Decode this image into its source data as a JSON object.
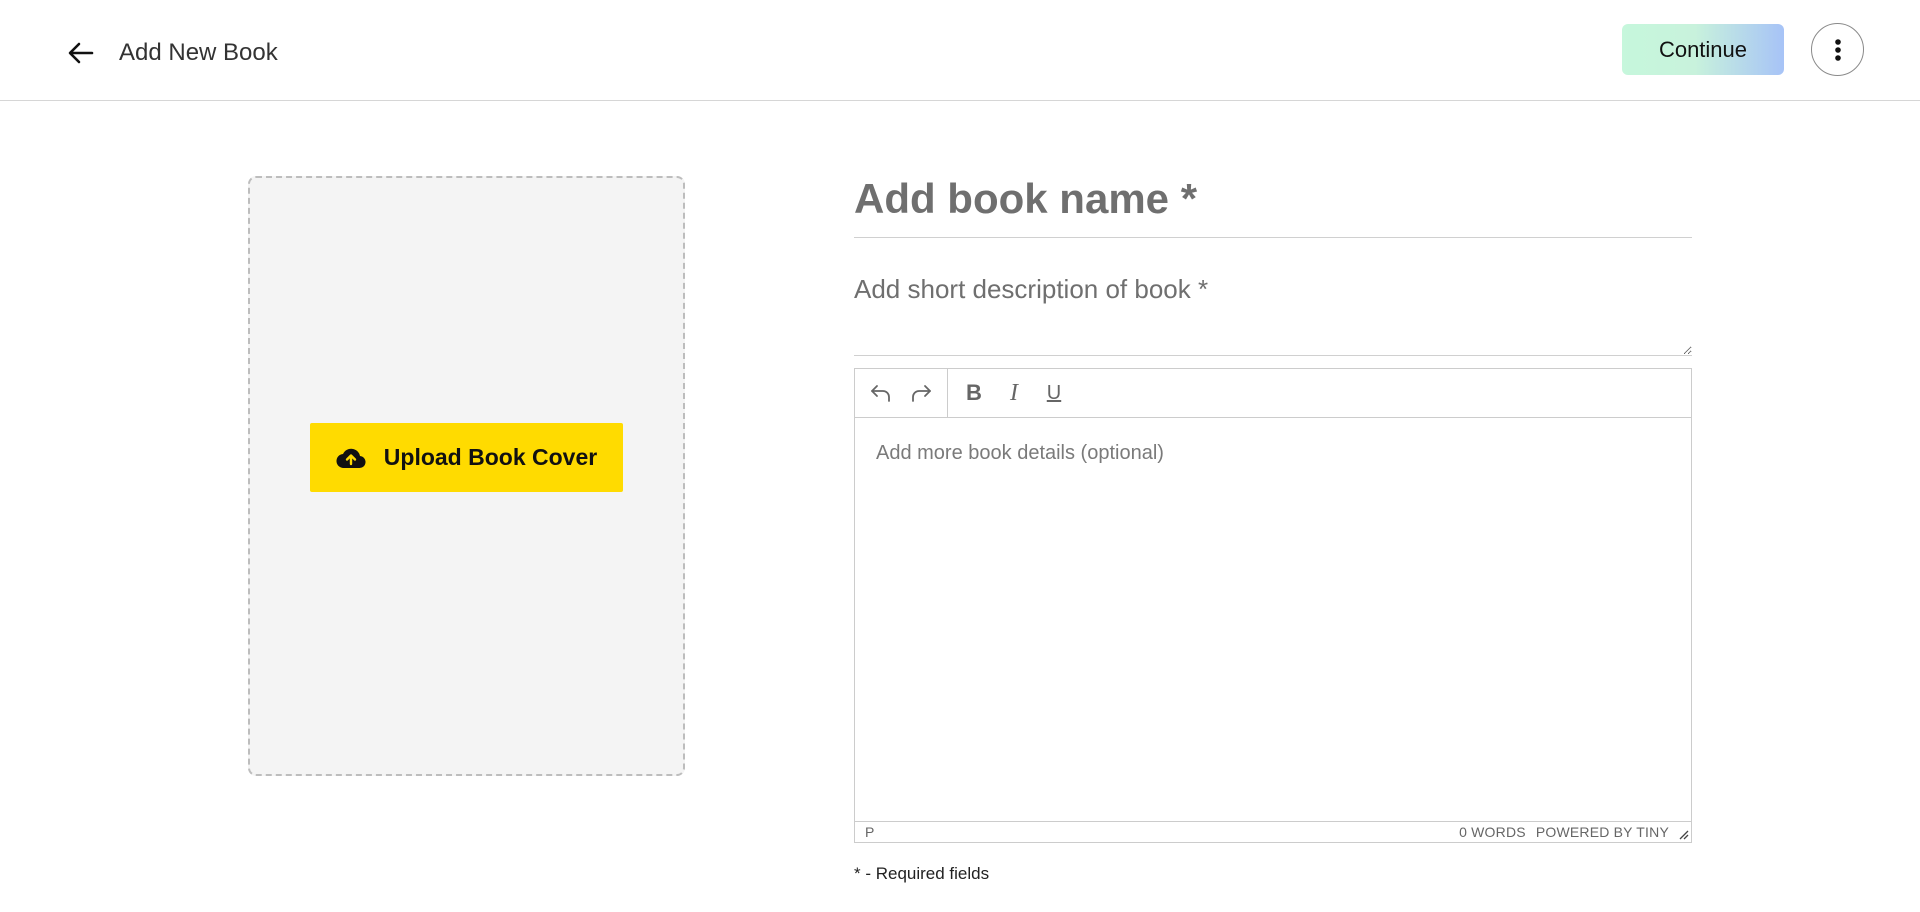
{
  "header": {
    "back_icon": "arrow-left-icon",
    "title": "Add New Book",
    "continue_label": "Continue",
    "more_icon": "more-vertical-icon"
  },
  "cover": {
    "upload_label": "Upload Book Cover",
    "upload_icon": "cloud-upload-icon"
  },
  "form": {
    "name_placeholder": "Add book name *",
    "name_value": "",
    "description_placeholder": "Add short description of book *",
    "description_value": "",
    "editor": {
      "toolbar": {
        "undo_icon": "undo-icon",
        "redo_icon": "redo-icon",
        "bold_label": "B",
        "italic_label": "I",
        "underline_label": "U"
      },
      "placeholder": "Add more book details (optional)",
      "status_path": "P",
      "word_count": "0 WORDS",
      "powered_by": "POWERED BY TINY"
    },
    "required_note": "* - Required fields"
  },
  "colors": {
    "upload_button": "#ffdb00",
    "continue_gradient_start": "#c6f7dc",
    "continue_gradient_end": "#a7c3f7",
    "cover_background": "#f4f4f4"
  }
}
